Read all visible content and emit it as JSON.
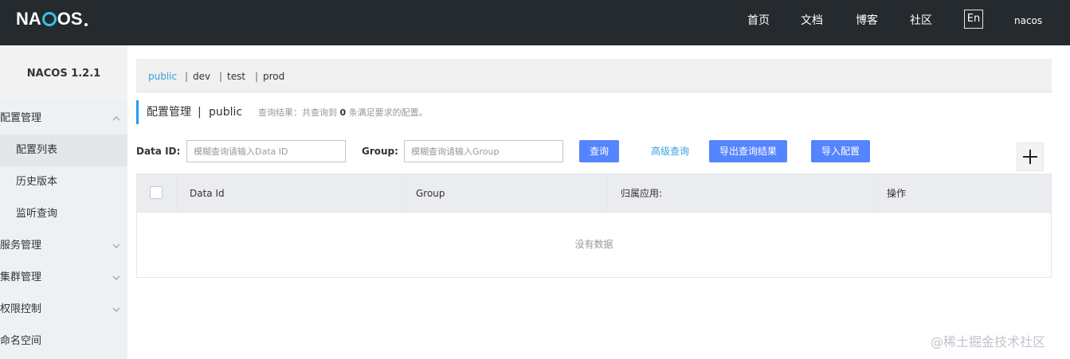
{
  "header": {
    "logo_text_1": "NA",
    "logo_text_2": "OS",
    "nav": [
      "首页",
      "文档",
      "博客",
      "社区"
    ],
    "lang": "En",
    "user": "nacos"
  },
  "sidebar": {
    "version": "NACOS 1.2.1",
    "items": [
      {
        "label": "配置管理",
        "type": "group",
        "expanded": true
      },
      {
        "label": "配置列表",
        "type": "sub",
        "active": true
      },
      {
        "label": "历史版本",
        "type": "sub"
      },
      {
        "label": "监听查询",
        "type": "sub"
      },
      {
        "label": "服务管理",
        "type": "group",
        "expanded": false
      },
      {
        "label": "集群管理",
        "type": "group",
        "expanded": false
      },
      {
        "label": "权限控制",
        "type": "group",
        "expanded": false
      },
      {
        "label": "命名空间",
        "type": "group"
      }
    ]
  },
  "namespaces": [
    "public",
    "dev",
    "test",
    "prod"
  ],
  "namespace_separator": "|",
  "page": {
    "title": "配置管理",
    "separator": "|",
    "namespace": "public",
    "query_result_prefix": "查询结果：共查询到",
    "query_result_count": "0",
    "query_result_suffix": "条满足要求的配置。"
  },
  "filters": {
    "data_id_label": "Data ID:",
    "data_id_placeholder": "模糊查询请输入Data ID",
    "group_label": "Group:",
    "group_placeholder": "模糊查询请输入Group",
    "search_button": "查询",
    "advanced_query": "高级查询",
    "export_button": "导出查询结果",
    "import_button": "导入配置"
  },
  "table": {
    "columns": [
      "Data Id",
      "Group",
      "归属应用:",
      "操作"
    ],
    "empty_text": "没有数据"
  },
  "watermark": "@稀土掘金技术社区",
  "colors": {
    "header_bg": "#252a2f",
    "primary": "#5584ff",
    "link": "#33a3dc",
    "accent_bar": "#209bfa"
  }
}
